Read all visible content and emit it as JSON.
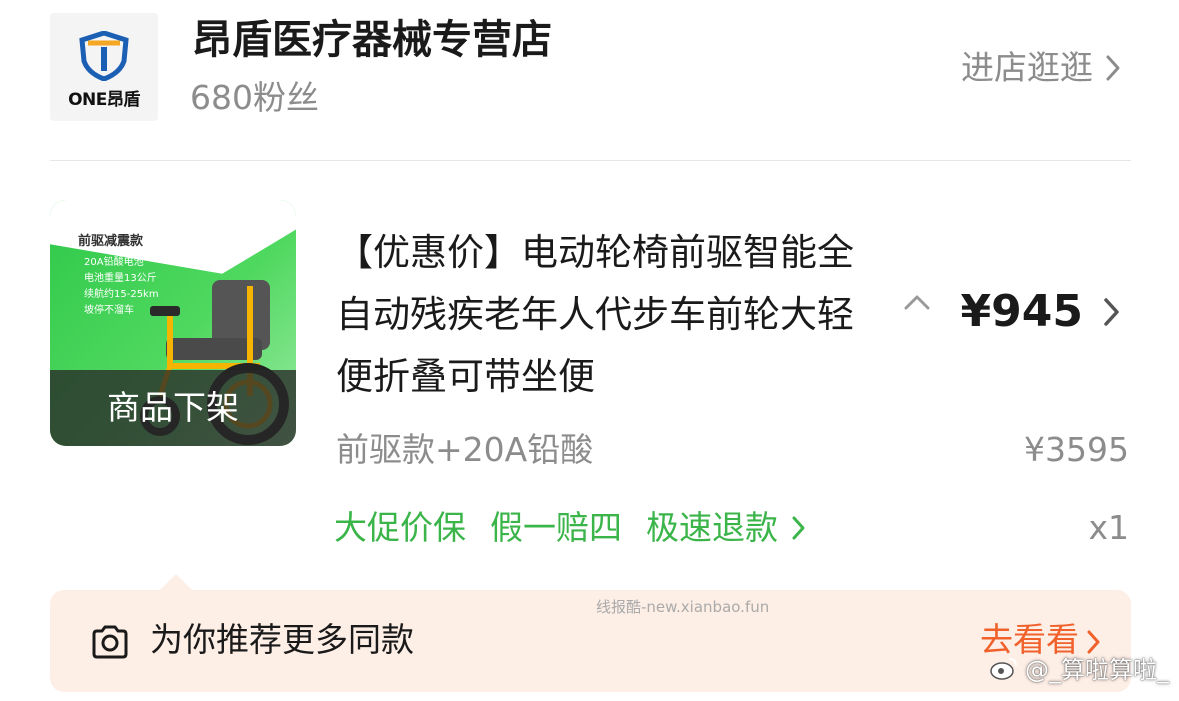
{
  "store": {
    "logo_text": "ONE昂盾",
    "name": "昂盾医疗器械专营店",
    "fans": "680粉丝",
    "visit_label": "进店逛逛"
  },
  "product": {
    "thumbnail": {
      "banner_title": "前驱减震款",
      "specs": [
        "20A铅酸电池",
        "电池重量13公斤",
        "续航约15-25km",
        "坡停不溜车"
      ],
      "status": "商品下架"
    },
    "title": "【优惠价】电动轮椅前驱智能全自动残疾老年人代步车前轮大轻便折叠可带坐便",
    "price": "¥945",
    "variant": "前驱款+20A铅酸",
    "original_price": "¥3595",
    "guarantees": [
      "大促价保",
      "假一赔四",
      "极速退款"
    ],
    "quantity": "x1"
  },
  "recommend": {
    "text": "为你推荐更多同款",
    "action": "去看看"
  },
  "watermarks": {
    "middle": "线报酷-new.xianbao.fun",
    "corner": "@_算啦算啦_"
  },
  "colors": {
    "accent_green": "#3bb54a",
    "accent_orange": "#f0612b",
    "reco_bg": "#fdeee6",
    "muted_text": "#8c8c8c"
  },
  "icons": {
    "visit": "chevron-right-icon",
    "collapse": "caret-up-icon",
    "price": "chevron-right-icon",
    "guarantee": "chevron-right-icon",
    "recommend": "camera-icon",
    "go": "chevron-right-icon"
  }
}
